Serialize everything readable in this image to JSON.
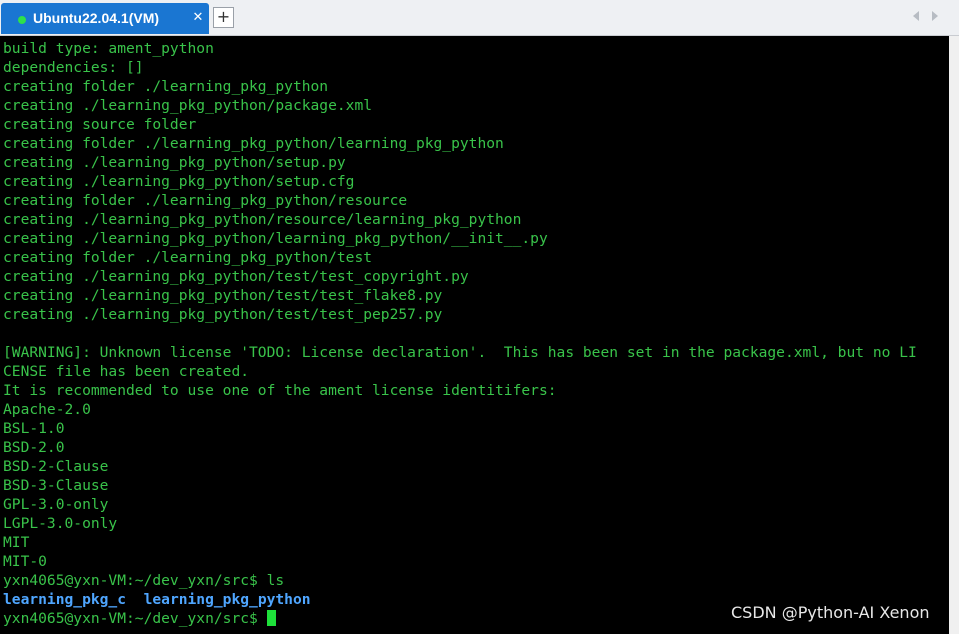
{
  "tab": {
    "title": "Ubuntu22.04.1(VM)",
    "close_glyph": "✕",
    "status_color": "#2ee04a",
    "status_icon": "connected-dot-icon"
  },
  "tabbar": {
    "new_tab_glyph": "+",
    "scroll_left_icon": "chevron-left-icon",
    "scroll_right_icon": "chevron-right-icon"
  },
  "terminal": {
    "colors": {
      "text": "#39c34a",
      "directory": "#4fa6ff",
      "cursor": "#1ee03a",
      "background": "#000000"
    },
    "lines": [
      "build type: ament_python",
      "dependencies: []",
      "creating folder ./learning_pkg_python",
      "creating ./learning_pkg_python/package.xml",
      "creating source folder",
      "creating folder ./learning_pkg_python/learning_pkg_python",
      "creating ./learning_pkg_python/setup.py",
      "creating ./learning_pkg_python/setup.cfg",
      "creating folder ./learning_pkg_python/resource",
      "creating ./learning_pkg_python/resource/learning_pkg_python",
      "creating ./learning_pkg_python/learning_pkg_python/__init__.py",
      "creating folder ./learning_pkg_python/test",
      "creating ./learning_pkg_python/test/test_copyright.py",
      "creating ./learning_pkg_python/test/test_flake8.py",
      "creating ./learning_pkg_python/test/test_pep257.py",
      "",
      "[WARNING]: Unknown license 'TODO: License declaration'.  This has been set in the package.xml, but no LI",
      "CENSE file has been created.",
      "It is recommended to use one of the ament license identitifers:",
      "Apache-2.0",
      "BSL-1.0",
      "BSD-2.0",
      "BSD-2-Clause",
      "BSD-3-Clause",
      "GPL-3.0-only",
      "LGPL-3.0-only",
      "MIT",
      "MIT-0",
      "yxn4065@yxn-VM:~/dev_yxn/src$ ls"
    ],
    "ls_output": [
      "learning_pkg_c",
      "learning_pkg_python"
    ],
    "ls_separator": "  ",
    "prompt": "yxn4065@yxn-VM:~/dev_yxn/src$ "
  },
  "watermark": "CSDN @Python-AI Xenon"
}
